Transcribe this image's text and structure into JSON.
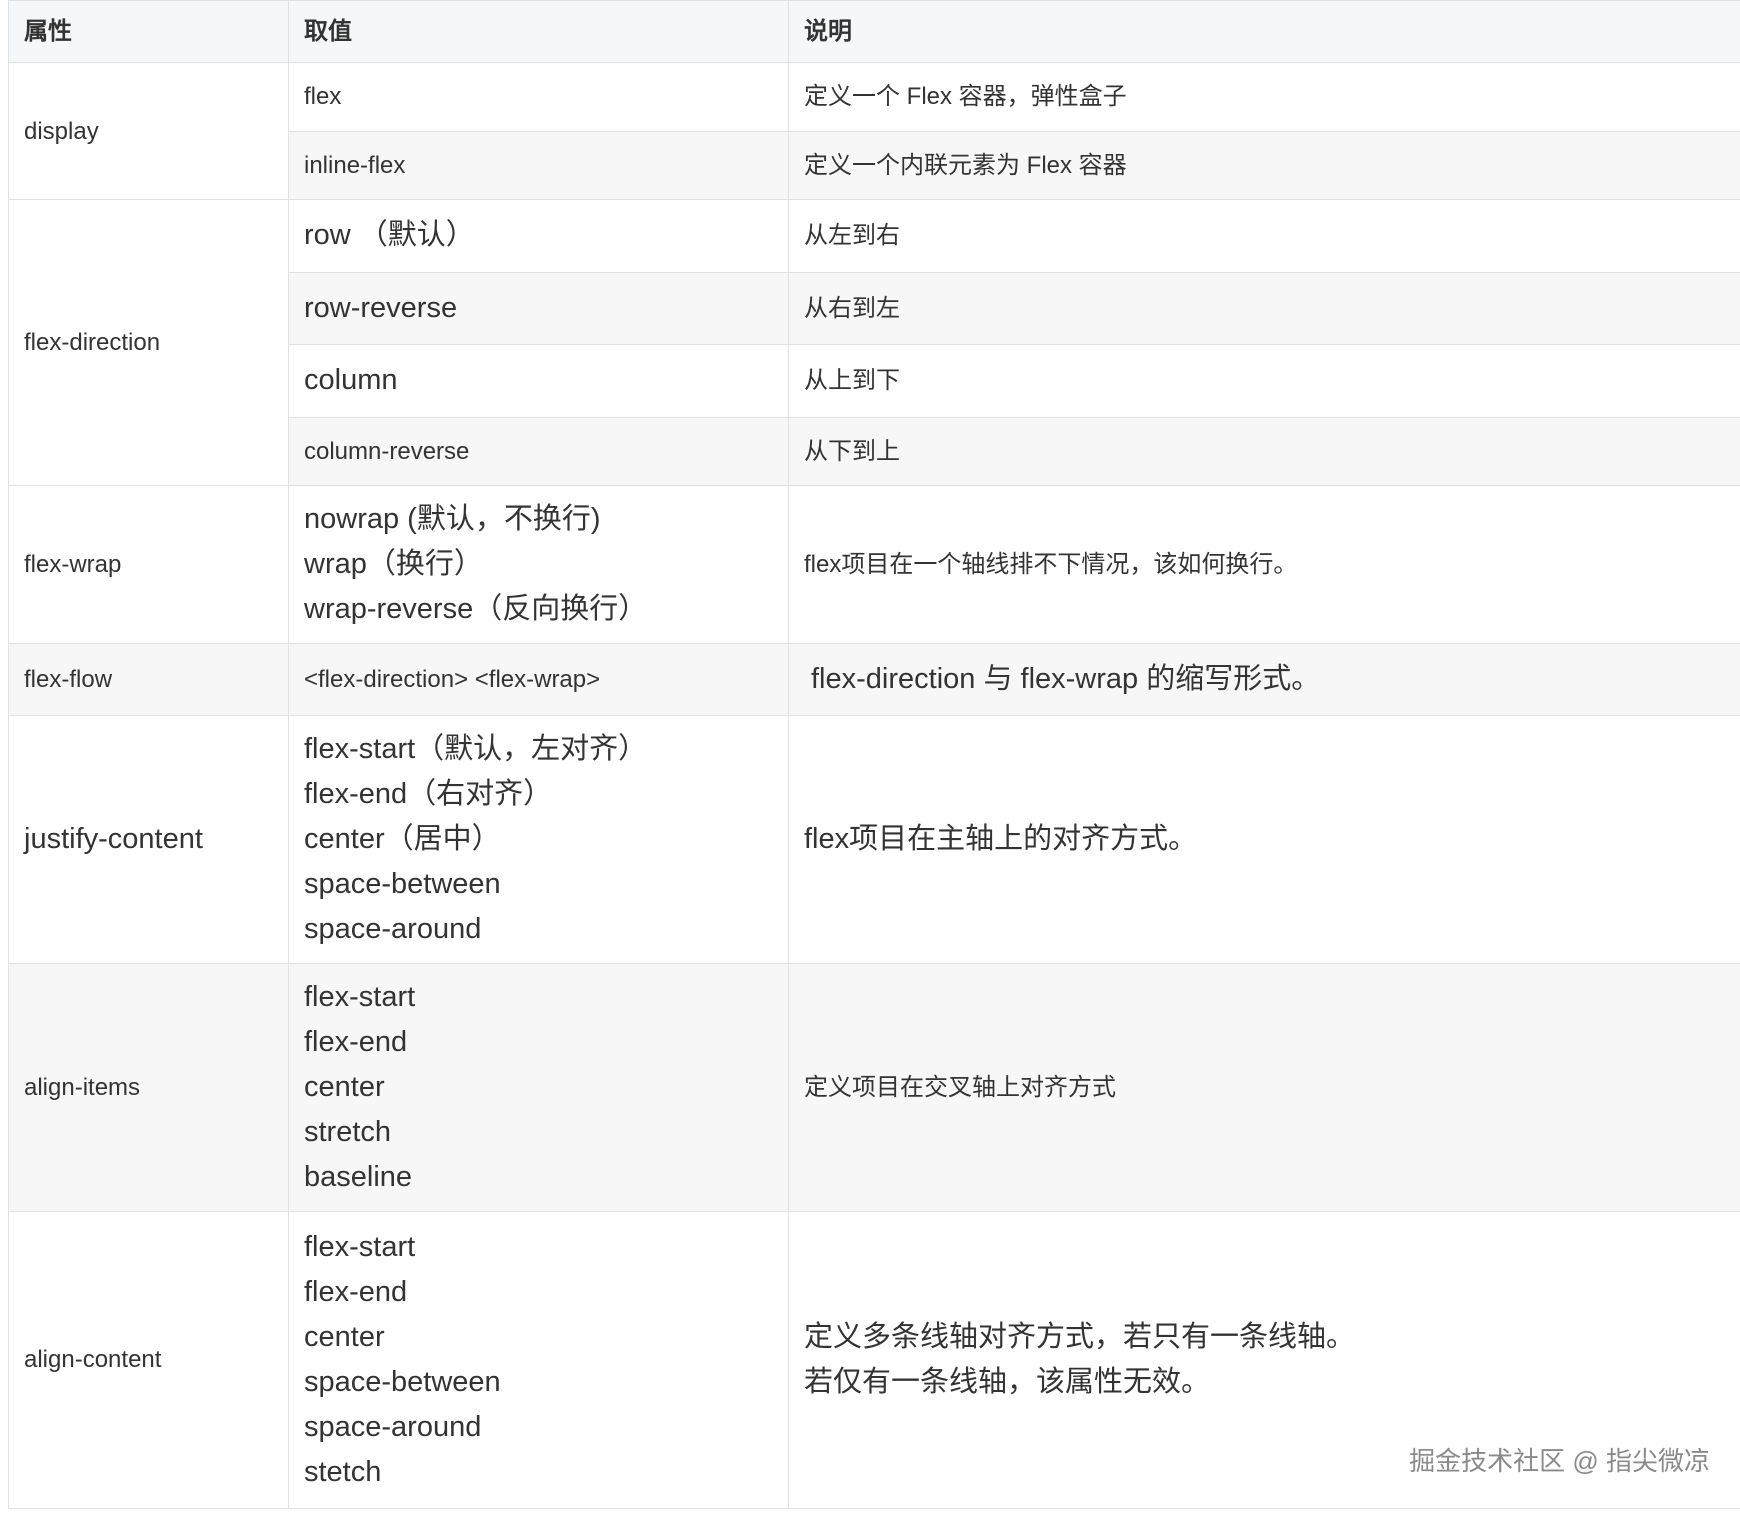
{
  "table": {
    "headers": {
      "property": "属性",
      "value": "取值",
      "description": "说明"
    },
    "rows": {
      "display": {
        "property": "display",
        "values": [
          "flex",
          "inline-flex"
        ],
        "descriptions": [
          "定义一个 Flex 容器，弹性盒子",
          "定义一个内联元素为 Flex 容器"
        ]
      },
      "flex_direction": {
        "property": "flex-direction",
        "values": [
          "row （默认）",
          "row-reverse",
          "column",
          "column-reverse"
        ],
        "descriptions": [
          "从左到右",
          "从右到左",
          "从上到下",
          "从下到上"
        ]
      },
      "flex_wrap": {
        "property": "flex-wrap",
        "values": [
          "nowrap (默认，不换行)",
          "wrap（换行）",
          "wrap-reverse（反向换行）"
        ],
        "description": "flex项目在一个轴线排不下情况，该如何换行。"
      },
      "flex_flow": {
        "property": "flex-flow",
        "value": "<flex-direction> <flex-wrap>",
        "description": "flex-direction 与 flex-wrap 的缩写形式。"
      },
      "justify_content": {
        "property": "justify-content",
        "values": [
          "flex-start（默认，左对齐）",
          "flex-end（右对齐）",
          "center（居中）",
          "space-between",
          "space-around"
        ],
        "description": "flex项目在主轴上的对齐方式。"
      },
      "align_items": {
        "property": "align-items",
        "values": [
          "flex-start",
          "flex-end",
          "center",
          "stretch",
          "baseline"
        ],
        "description": "定义项目在交叉轴上对齐方式"
      },
      "align_content": {
        "property": "align-content",
        "values": [
          "flex-start",
          "flex-end",
          "center",
          "space-between",
          "space-around",
          "stetch"
        ],
        "descriptions": [
          "定义多条线轴对齐方式，若只有一条线轴。",
          "若仅有一条线轴，该属性无效。"
        ]
      }
    }
  },
  "watermark": "掘金技术社区 @ 指尖微凉"
}
